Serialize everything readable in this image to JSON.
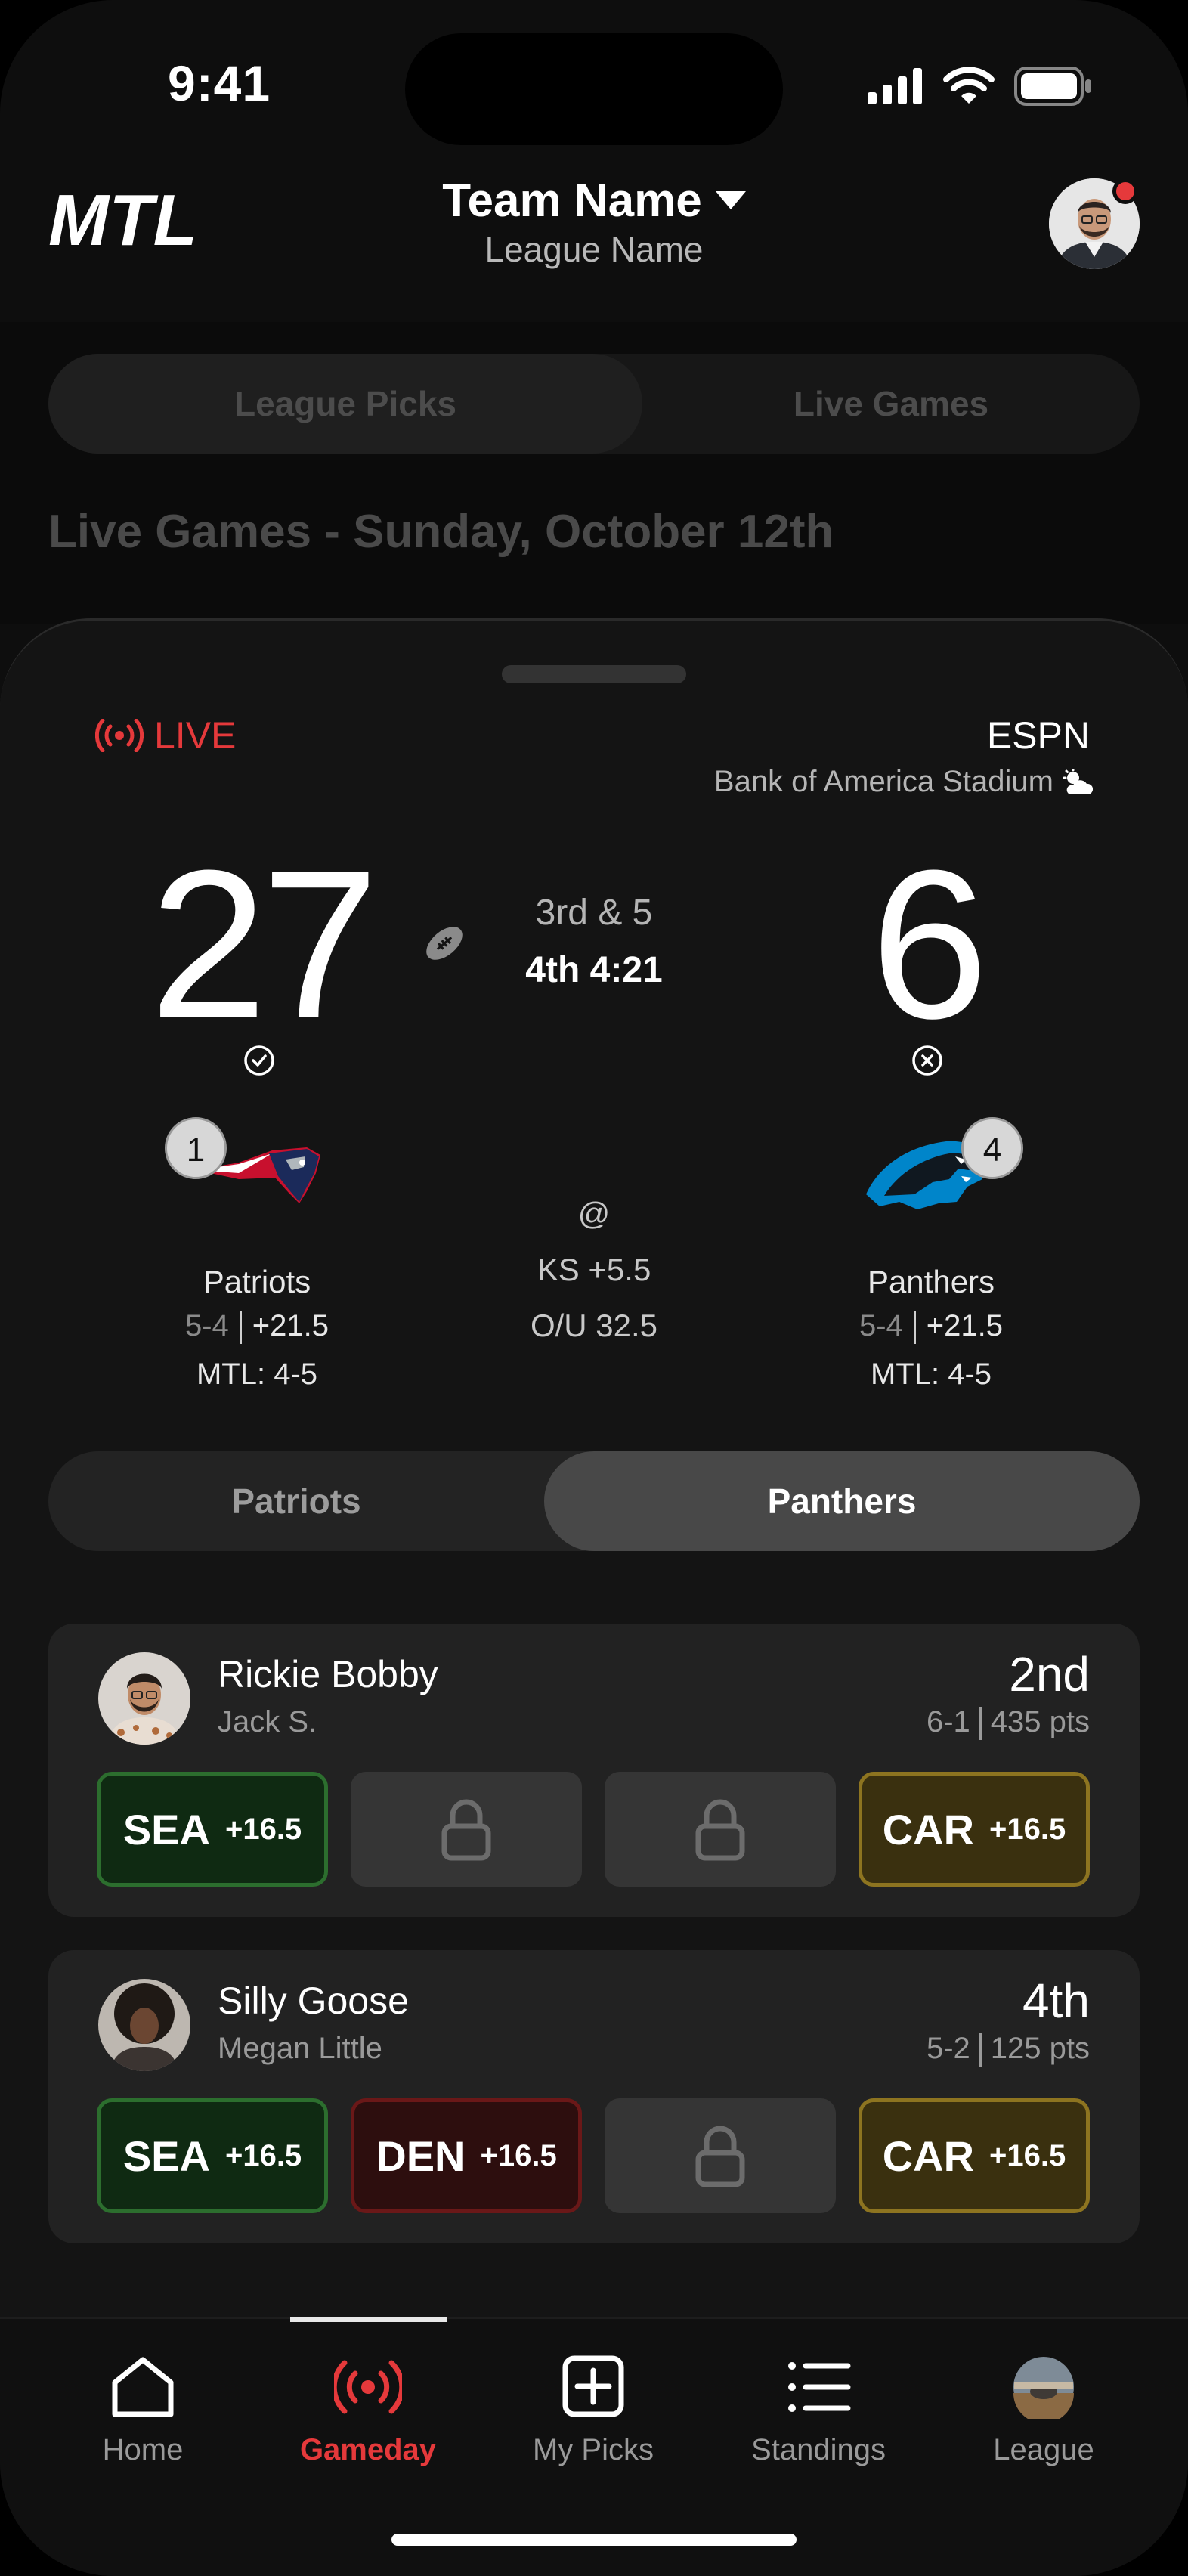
{
  "status_bar": {
    "time": "9:41"
  },
  "header": {
    "logo": "MTL",
    "team_name": "Team Name",
    "league_name": "League Name"
  },
  "segment": {
    "tabs": [
      {
        "label": "League Picks",
        "active": true
      },
      {
        "label": "Live Games",
        "active": false
      }
    ]
  },
  "section_title": "Live Games - Sunday, October 12th",
  "game": {
    "status": "LIVE",
    "network": "ESPN",
    "stadium": "Bank of America Stadium",
    "down": "3rd & 5",
    "clock": "4th 4:21",
    "at": "@",
    "spread": "KS +5.5",
    "over_under": "O/U 32.5",
    "home": {
      "score": "27",
      "seed": "1",
      "name": "Patriots",
      "record": "5-4",
      "line": "+21.5",
      "mtl": "MTL: 4-5"
    },
    "away": {
      "score": "6",
      "seed": "4",
      "name": "Panthers",
      "record": "5-4",
      "line": "+21.5",
      "mtl": "MTL: 4-5"
    }
  },
  "team_toggle": {
    "tabs": [
      {
        "label": "Patriots",
        "active": false
      },
      {
        "label": "Panthers",
        "active": true
      }
    ]
  },
  "players": [
    {
      "name": "Rickie Bobby",
      "owner": "Jack S.",
      "rank": "2nd",
      "record": "6-1",
      "points": "435 pts",
      "picks": [
        {
          "abbr": "SEA",
          "line": "+16.5",
          "state": "green"
        },
        {
          "abbr": "",
          "line": "",
          "state": "locked"
        },
        {
          "abbr": "",
          "line": "",
          "state": "locked"
        },
        {
          "abbr": "CAR",
          "line": "+16.5",
          "state": "gold"
        }
      ]
    },
    {
      "name": "Silly Goose",
      "owner": "Megan Little",
      "rank": "4th",
      "record": "5-2",
      "points": "125 pts",
      "picks": [
        {
          "abbr": "SEA",
          "line": "+16.5",
          "state": "green"
        },
        {
          "abbr": "DEN",
          "line": "+16.5",
          "state": "red"
        },
        {
          "abbr": "",
          "line": "",
          "state": "locked"
        },
        {
          "abbr": "CAR",
          "line": "+16.5",
          "state": "gold"
        }
      ]
    }
  ],
  "nav": {
    "items": [
      {
        "label": "Home",
        "icon": "home-icon",
        "active": false
      },
      {
        "label": "Gameday",
        "icon": "live-broadcast-icon",
        "active": true
      },
      {
        "label": "My Picks",
        "icon": "plus-square-icon",
        "active": false
      },
      {
        "label": "Standings",
        "icon": "list-icon",
        "active": false
      },
      {
        "label": "League",
        "icon": "league-avatar-icon",
        "active": false
      }
    ]
  },
  "colors": {
    "accent": "#e5393b",
    "win": "#2c6e2e",
    "loss": "#6a1818",
    "pending": "#8d7420"
  }
}
